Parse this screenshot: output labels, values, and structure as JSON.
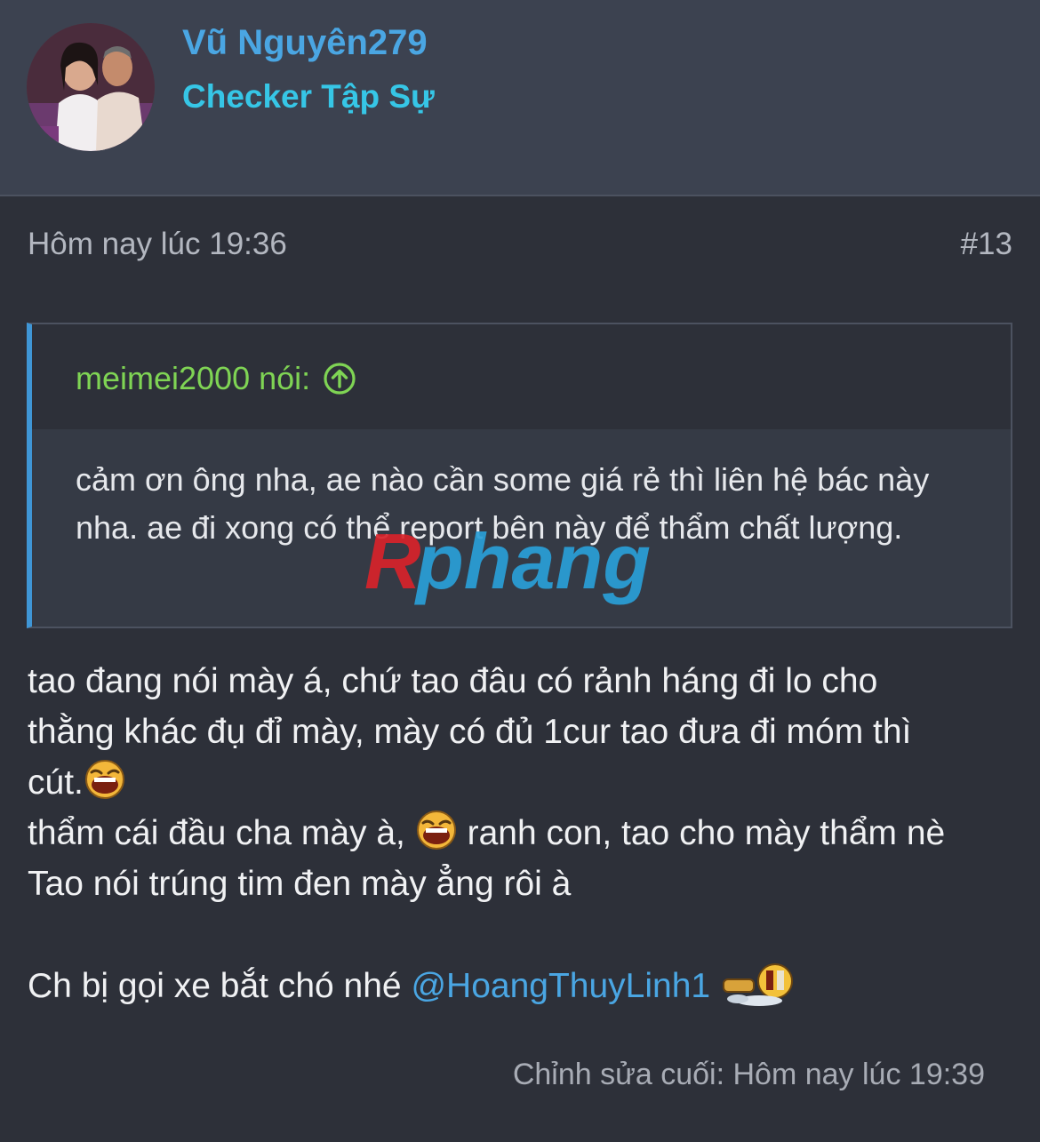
{
  "user": {
    "name": "Vũ Nguyên279",
    "title": "Checker Tập Sự",
    "avatar_icon": "user-avatar-photo"
  },
  "post": {
    "date": "Hôm nay lúc 19:36",
    "number": "#13",
    "quote": {
      "author": "meimei2000 nói:",
      "arrow_icon": "circle-up-arrow-icon",
      "text": "cảm ơn ông nha, ae nào cần some giá rẻ thì liên hệ bác này nha. ae đi xong có thể report bên này để thẩm chất lượng."
    },
    "body": {
      "line1": "tao đang nói mày á, chứ tao đâu có rảnh háng đi lo cho",
      "line2": "thằng khác đụ đỉ mày, mày có đủ 1cur tao đưa đi móm thì",
      "line3": "cút.",
      "line4a": "thẩm cái đầu cha mày à,",
      "line4b": "ranh con, tao cho mày thẩm nè",
      "line5": "Tao nói trúng tim đen mày ẳng rôi à",
      "line6": "Ch bị gọi xe bắt chó nhé",
      "mention": "@HoangThuyLinh1"
    },
    "edited": "Chỉnh sửa cuối: Hôm nay lúc 19:39"
  },
  "watermark": {
    "text": "Rphang",
    "colors": [
      "#d8232a",
      "#2a9fd8"
    ]
  },
  "colors": {
    "username": "#4aa6e3",
    "title": "#36c6e6",
    "quote_author": "#7fd454",
    "quote_border": "#3f96d6",
    "mention": "#4aa6e3"
  }
}
